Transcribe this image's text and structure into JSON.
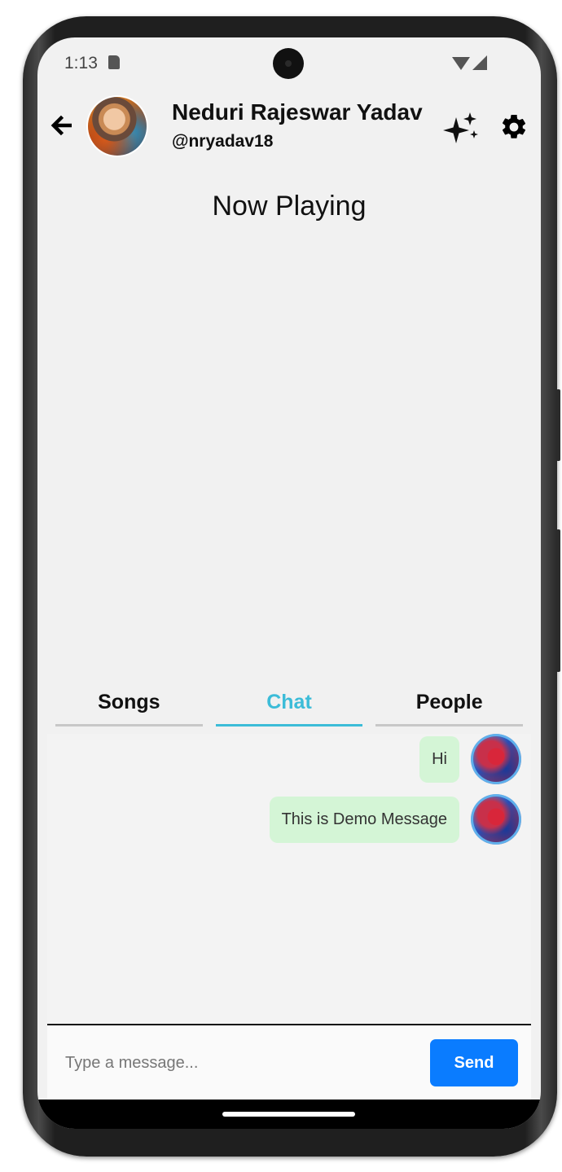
{
  "status_bar": {
    "time": "1:13"
  },
  "header": {
    "name": "Neduri Rajeswar Yadav",
    "handle": "@nryadav18"
  },
  "now_playing": "Now Playing",
  "tabs": [
    {
      "label": "Songs",
      "active": false
    },
    {
      "label": "Chat",
      "active": true
    },
    {
      "label": "People",
      "active": false
    }
  ],
  "chat": {
    "messages": [
      {
        "text": "Hi"
      },
      {
        "text": "This is Demo Message"
      }
    ]
  },
  "composer": {
    "placeholder": "Type a message...",
    "send_label": "Send"
  },
  "colors": {
    "accent_tab": "#3cbcd8",
    "send_button": "#0a7cff",
    "bubble": "#d4f5d6"
  }
}
